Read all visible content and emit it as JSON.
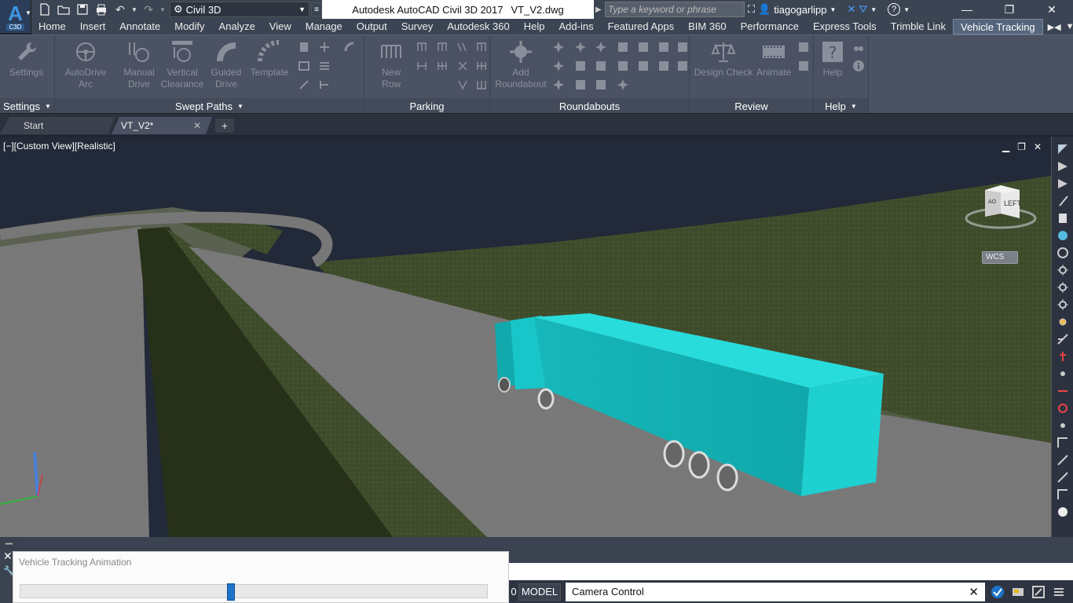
{
  "app": {
    "logo_text": "A",
    "logo_sub": "C3D",
    "title": "Autodesk AutoCAD Civil 3D 2017",
    "file": "VT_V2.dwg"
  },
  "workspace": {
    "value": "Civil 3D"
  },
  "search": {
    "placeholder": "Type a keyword or phrase"
  },
  "user": {
    "name": "tiagogarlipp"
  },
  "ribbon_tabs": [
    "Home",
    "Insert",
    "Annotate",
    "Modify",
    "Analyze",
    "View",
    "Manage",
    "Output",
    "Survey",
    "Autodesk 360",
    "Help",
    "Add-ins",
    "Featured Apps",
    "BIM 360",
    "Performance",
    "Express Tools",
    "Trimble Link",
    "Vehicle Tracking"
  ],
  "active_tab": "Vehicle Tracking",
  "ribbon": {
    "settings": {
      "title": "Settings",
      "btn": "Settings"
    },
    "swept": {
      "title": "Swept Paths",
      "autodrive": "AutoDrive\nArc",
      "manual": "Manual\nDrive",
      "vertical": "Vertical\nClearance",
      "guided": "Guided\nDrive",
      "template": "Template"
    },
    "parking": {
      "title": "Parking",
      "newrow": "New\nRow"
    },
    "roundabouts": {
      "title": "Roundabouts",
      "add": "Add\nRoundabout"
    },
    "review": {
      "title": "Review",
      "design": "Design Check",
      "animate": "Animate"
    },
    "help": {
      "title": "Help",
      "btn": "Help"
    }
  },
  "file_tabs": {
    "start": "Start",
    "doc": "VT_V2*"
  },
  "viewport": {
    "label": "[−][Custom View][Realistic]",
    "viewcube_face": "LEFT",
    "viewcube_back": "AO",
    "wcs": "WCS"
  },
  "animation": {
    "title": "Vehicle Tracking Animation",
    "progress": 0.45
  },
  "status": {
    "zero": "0",
    "model": "MODEL",
    "command": "Camera Control"
  },
  "colors": {
    "truck": "#1fd0d0",
    "accent": "#1e73c8",
    "sky": "#222938",
    "grass": "#3e4b2c"
  }
}
